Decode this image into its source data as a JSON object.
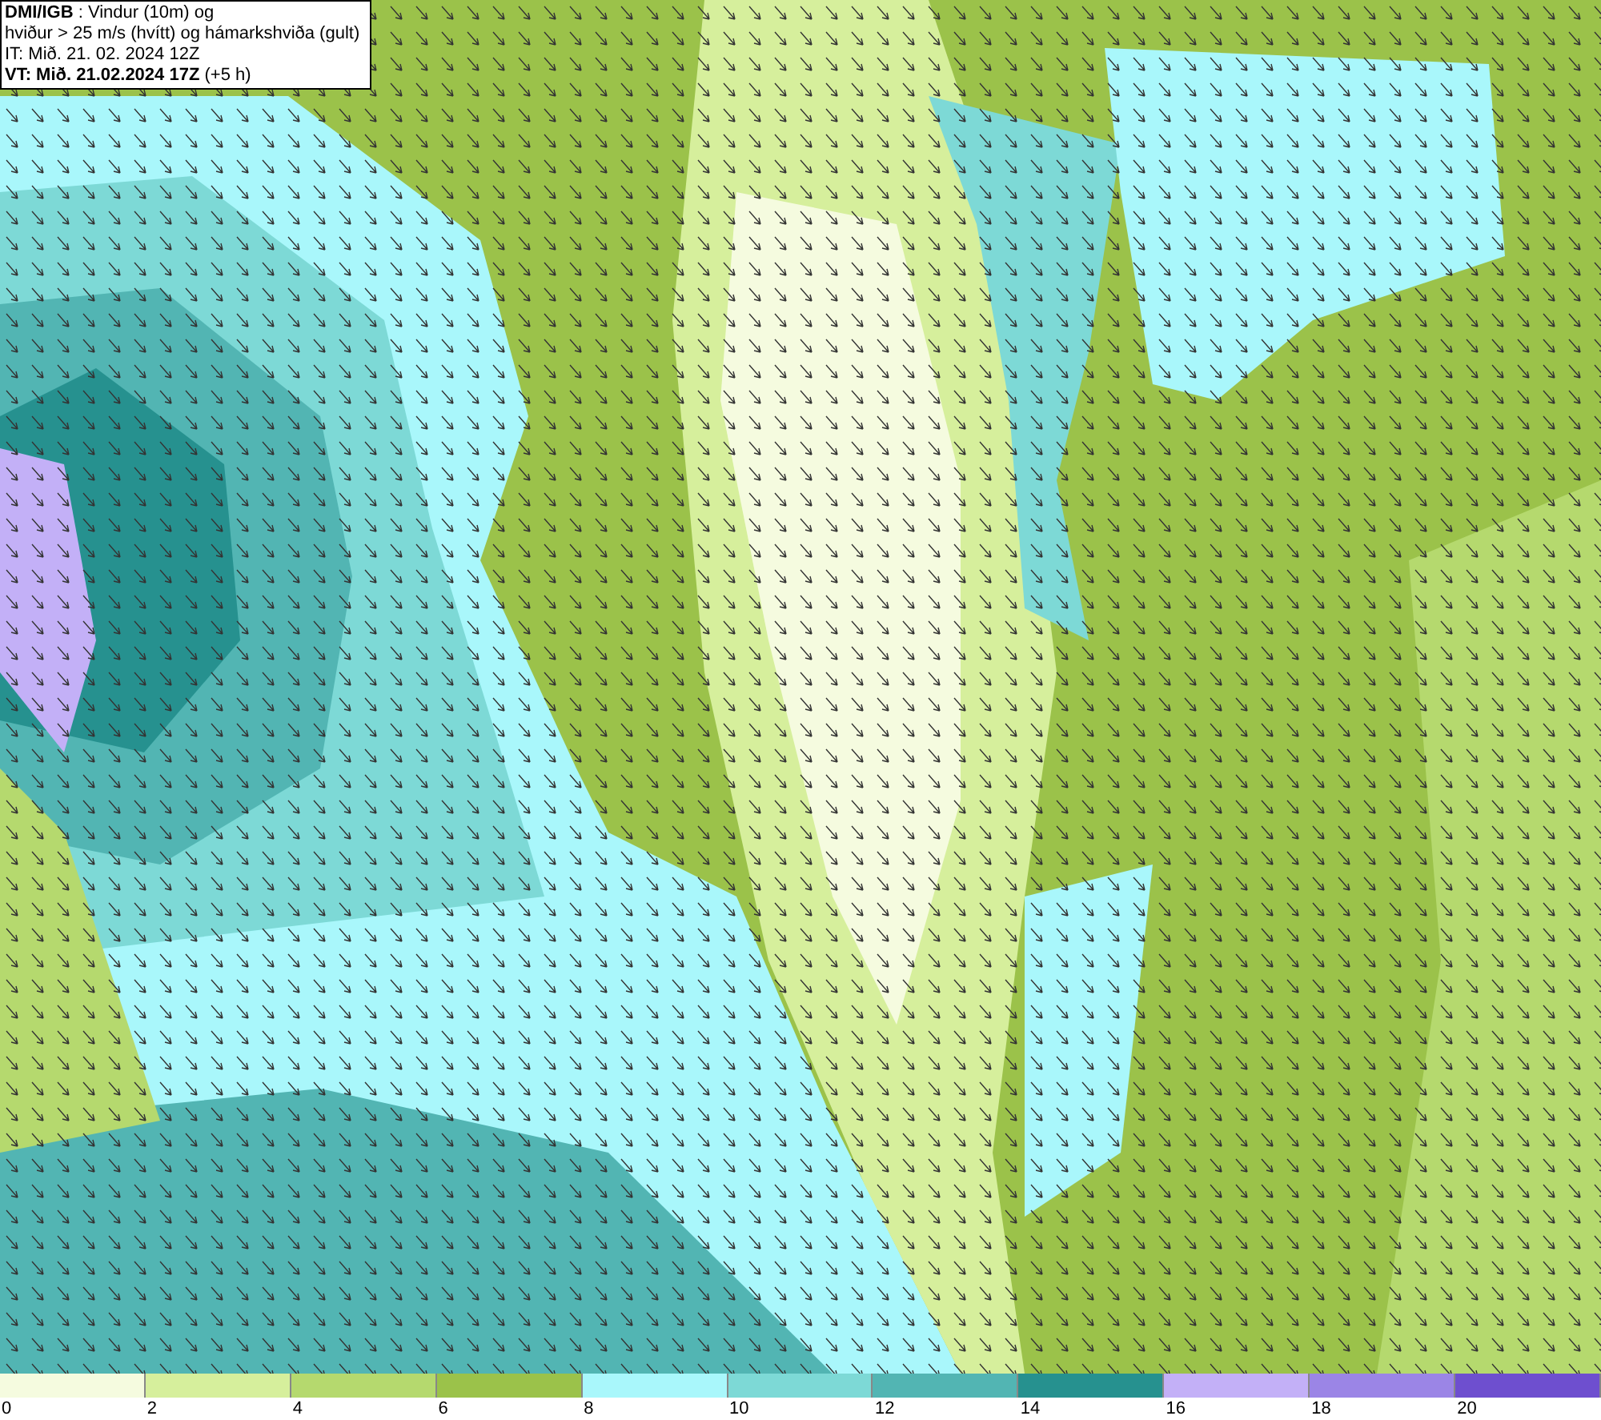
{
  "title_box": {
    "lines": [
      "**DMI/IGB** : Vindur (10m) og",
      "hviður > 25 m/s (hvítt) og hámarkshviða (gult)",
      "IT: Mið. 21. 02. 2024 12Z",
      "**VT: Mið. 21.02.2024 17Z** (+5 h)"
    ]
  },
  "legend": {
    "swatches": [
      {
        "color": "#f5fbdf"
      },
      {
        "color": "#d6ef9c"
      },
      {
        "color": "#b5d96e"
      },
      {
        "color": "#9bc24a"
      },
      {
        "color": "#a9f7fb"
      },
      {
        "color": "#7dd9d6"
      },
      {
        "color": "#52b5b3"
      },
      {
        "color": "#26918f"
      },
      {
        "color": "#c3b0f7"
      },
      {
        "color": "#9b85e6"
      },
      {
        "color": "#6e4fcf"
      }
    ],
    "labels": [
      "0",
      "2",
      "4",
      "6",
      "8",
      "10",
      "12",
      "14",
      "16",
      "18",
      "20"
    ]
  }
}
